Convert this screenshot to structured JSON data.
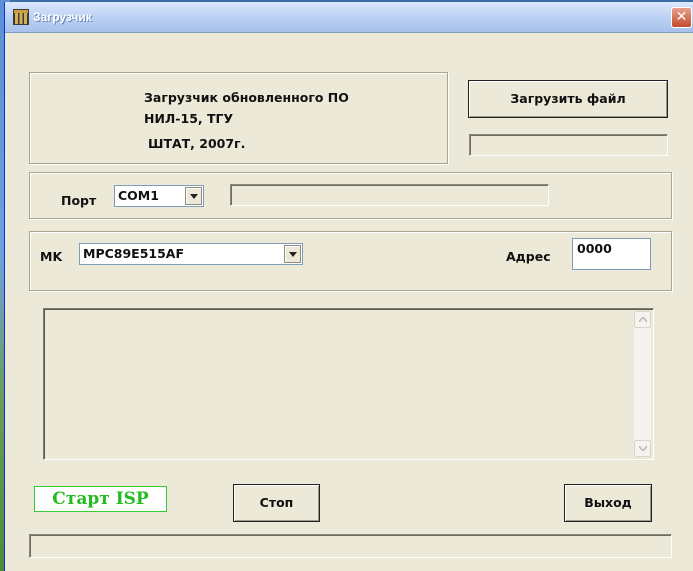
{
  "window": {
    "title": "Загрузчик",
    "close_glyph": "✕"
  },
  "info": {
    "line1": "Загрузчик обновленного ПО",
    "line2": "НИЛ-15, ТГУ",
    "line3": "ШТАТ, 2007г."
  },
  "buttons": {
    "load_file": "Загрузить файл",
    "start_isp": "Старт ISP",
    "stop": "Стоп",
    "exit": "Выход"
  },
  "port": {
    "label": "Порт",
    "value": "COM1"
  },
  "mk": {
    "label": "MK",
    "value": "MPC89E515AF"
  },
  "address": {
    "label": "Адрес",
    "value": "0000"
  },
  "log": {
    "text": ""
  },
  "icons": {
    "app": "app-icon",
    "close": "close-icon",
    "combo_arrow": "chevron-down-icon",
    "scroll_up": "scroll-up-icon",
    "scroll_down": "scroll-down-icon"
  },
  "colors": {
    "window_bg": "#ece9d8",
    "start_isp_text": "#22bb22",
    "start_isp_border": "#33cc33"
  }
}
